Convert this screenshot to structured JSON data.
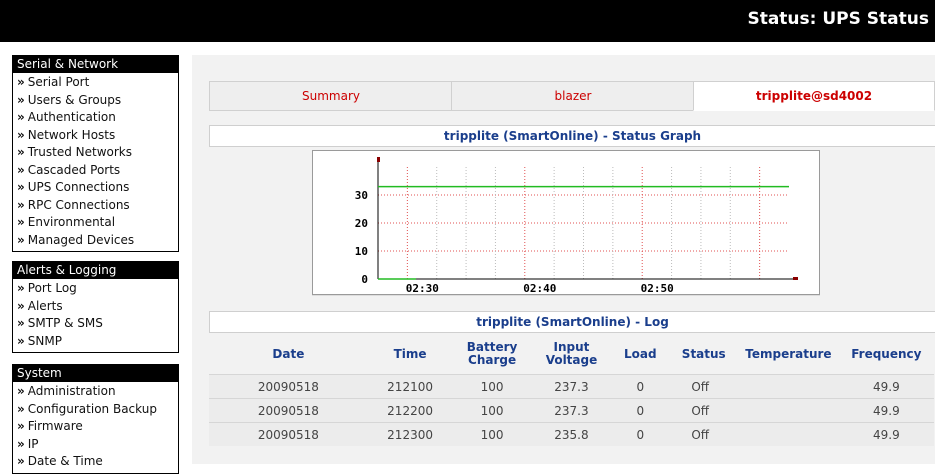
{
  "header": {
    "title": "Status: UPS Status"
  },
  "sidebar": {
    "groups": [
      {
        "title": "Serial & Network",
        "items": [
          "Serial Port",
          "Users & Groups",
          "Authentication",
          "Network Hosts",
          "Trusted Networks",
          "Cascaded Ports",
          "UPS Connections",
          "RPC Connections",
          "Environmental",
          "Managed Devices"
        ]
      },
      {
        "title": "Alerts & Logging",
        "items": [
          "Port Log",
          "Alerts",
          "SMTP & SMS",
          "SNMP"
        ]
      },
      {
        "title": "System",
        "items": [
          "Administration",
          "Configuration Backup",
          "Firmware",
          "IP",
          "Date & Time"
        ]
      }
    ],
    "chevron": "»"
  },
  "tabs": [
    "Summary",
    "blazer",
    "tripplite@sd4002"
  ],
  "graph": {
    "title": "tripplite (SmartOnline) - Status Graph"
  },
  "chart_data": {
    "type": "line",
    "x_ticks": [
      "02:30",
      "02:40",
      "02:50"
    ],
    "y_ticks": [
      "0",
      "10",
      "20",
      "30"
    ],
    "ylim": [
      0,
      40
    ],
    "grid": true,
    "series": [
      {
        "color": "#22bb22",
        "y_start": 0,
        "y_level": 33
      }
    ],
    "colors": {
      "grid": "#e05050",
      "axis": "#000000",
      "marker": "#8a0000"
    }
  },
  "log": {
    "title": "tripplite (SmartOnline) - Log",
    "columns": [
      [
        "Date"
      ],
      [
        "Time"
      ],
      [
        "Battery",
        "Charge"
      ],
      [
        "Input",
        "Voltage"
      ],
      [
        "Load"
      ],
      [
        "Status"
      ],
      [
        "Temperature"
      ],
      [
        "Frequency"
      ]
    ],
    "rows": [
      [
        "20090518",
        "212100",
        "100",
        "237.3",
        "0",
        "Off",
        "",
        "49.9"
      ],
      [
        "20090518",
        "212200",
        "100",
        "237.3",
        "0",
        "Off",
        "",
        "49.9"
      ],
      [
        "20090518",
        "212300",
        "100",
        "235.8",
        "0",
        "Off",
        "",
        "49.9"
      ]
    ]
  }
}
